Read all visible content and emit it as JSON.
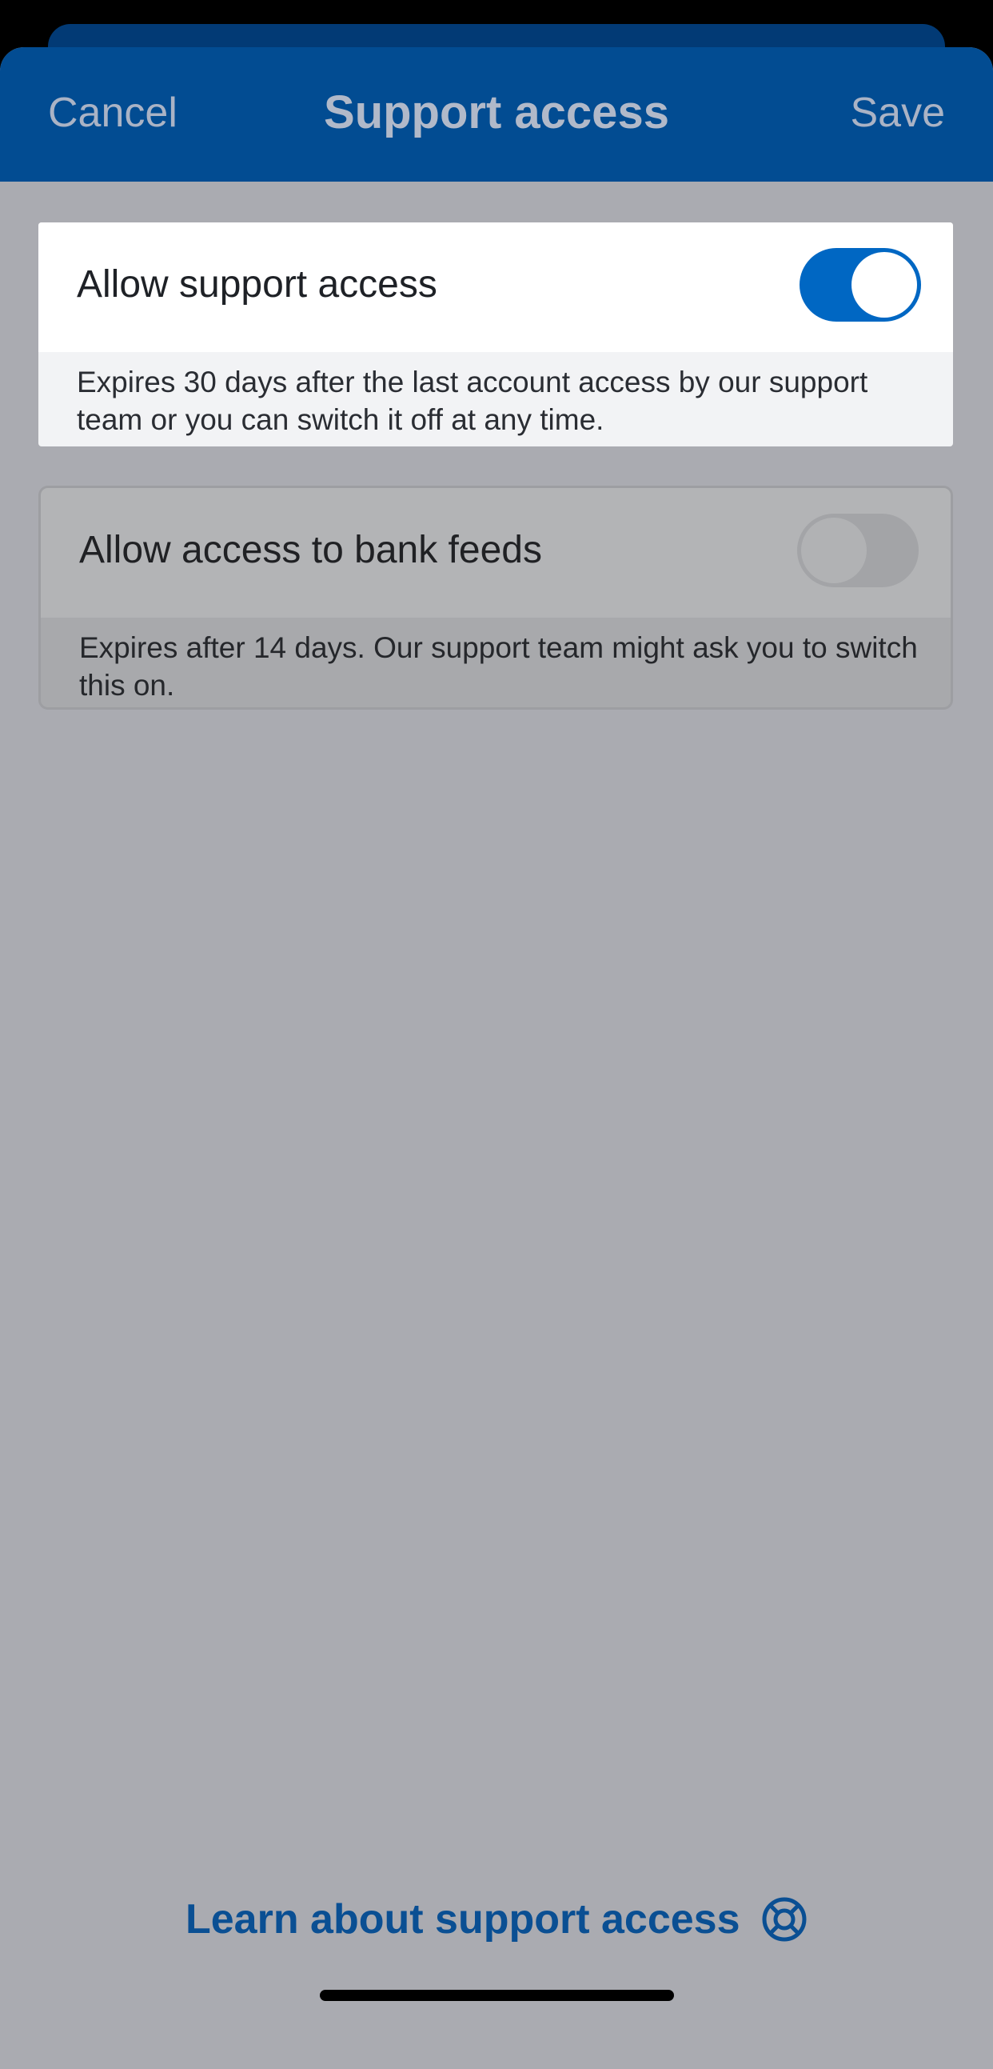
{
  "nav": {
    "cancel_label": "Cancel",
    "title": "Support access",
    "save_label": "Save"
  },
  "settings": [
    {
      "label": "Allow support access",
      "enabled": true,
      "description": "Expires 30 days after the last account access by our support team or you can switch it off at any time."
    },
    {
      "label": "Allow access to bank feeds",
      "enabled": false,
      "description": "Expires after 14 days. Our support team might ask you to switch this on."
    }
  ],
  "footer": {
    "learn_link": "Learn about support access",
    "link_icon": "lifebuoy-icon"
  },
  "colors": {
    "brand_blue": "#024c92",
    "toggle_on": "#0067c3",
    "link": "#0a4f93"
  }
}
